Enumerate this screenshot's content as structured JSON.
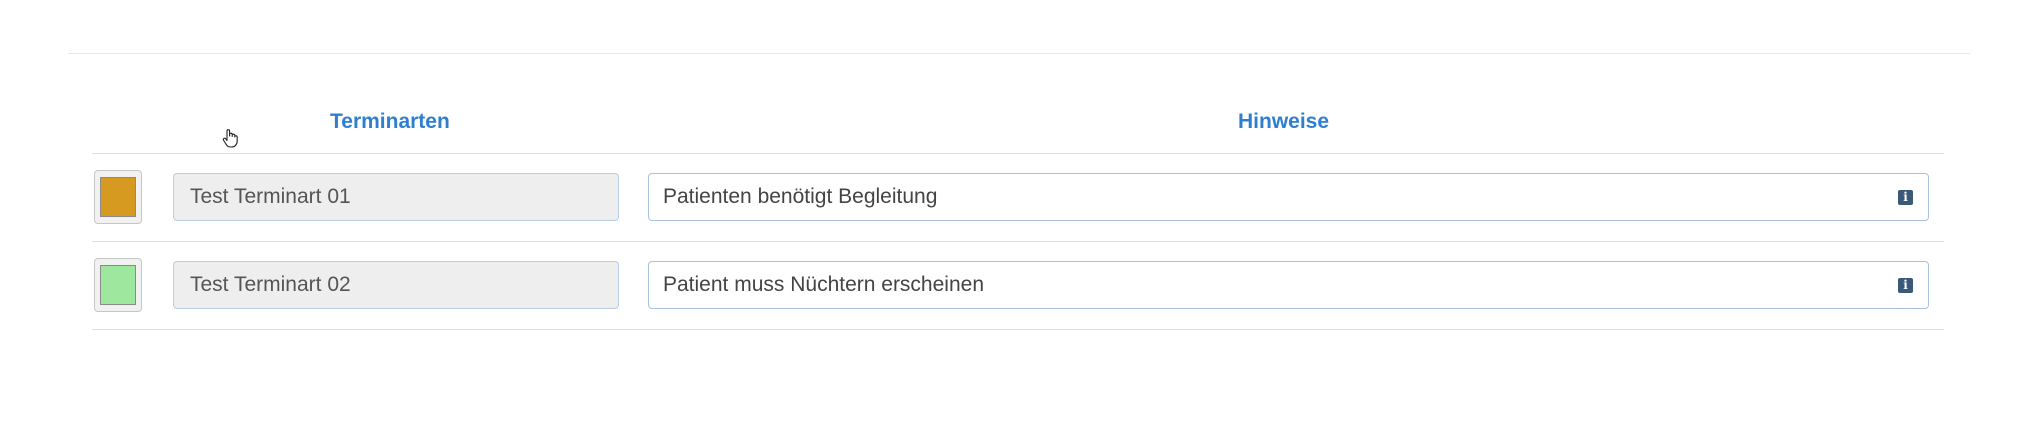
{
  "table": {
    "headers": {
      "terminarten": "Terminarten",
      "hinweise": "Hinweise"
    },
    "rows": [
      {
        "color": "#d79a20",
        "name": "Test Terminart 01",
        "hint": "Patienten benötigt Begleitung",
        "hint_icon": "info-icon"
      },
      {
        "color": "#9de89e",
        "name": "Test Terminart 02",
        "hint": "Patient muss Nüchtern erscheinen",
        "hint_icon": "info-icon"
      }
    ]
  },
  "cursor": {
    "icon": "hand-pointer-icon"
  }
}
